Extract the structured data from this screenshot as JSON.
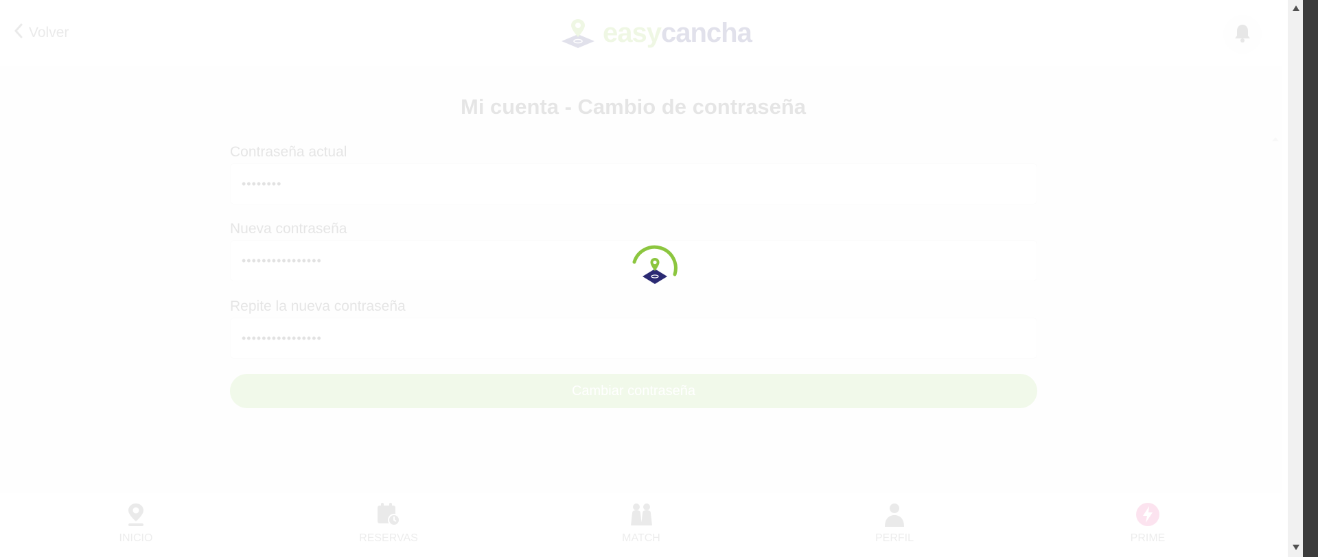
{
  "header": {
    "back_label": "Volver",
    "logo": {
      "part1": "easy",
      "part2": "cancha"
    }
  },
  "page": {
    "title": "Mi cuenta - Cambio de contraseña"
  },
  "form": {
    "current_password": {
      "label": "Contraseña actual",
      "value": "••••••••"
    },
    "new_password": {
      "label": "Nueva contraseña",
      "value": "••••••••••••••••"
    },
    "repeat_password": {
      "label": "Repite la nueva contraseña",
      "value": "••••••••••••••••"
    },
    "submit_label": "Cambiar contraseña"
  },
  "bottom_nav": {
    "items": [
      {
        "label": "INICIO",
        "icon": "location-pin-icon"
      },
      {
        "label": "RESERVAS",
        "icon": "calendar-clock-icon"
      },
      {
        "label": "MATCH",
        "icon": "players-icon"
      },
      {
        "label": "PERFIL",
        "icon": "person-icon"
      },
      {
        "label": "PRIME",
        "icon": "bolt-badge-icon"
      }
    ]
  },
  "loading": {
    "visible": true
  },
  "colors": {
    "brand_green": "#8cc63f",
    "brand_navy": "#2b2a73",
    "prime_pink": "#e83e8c"
  }
}
